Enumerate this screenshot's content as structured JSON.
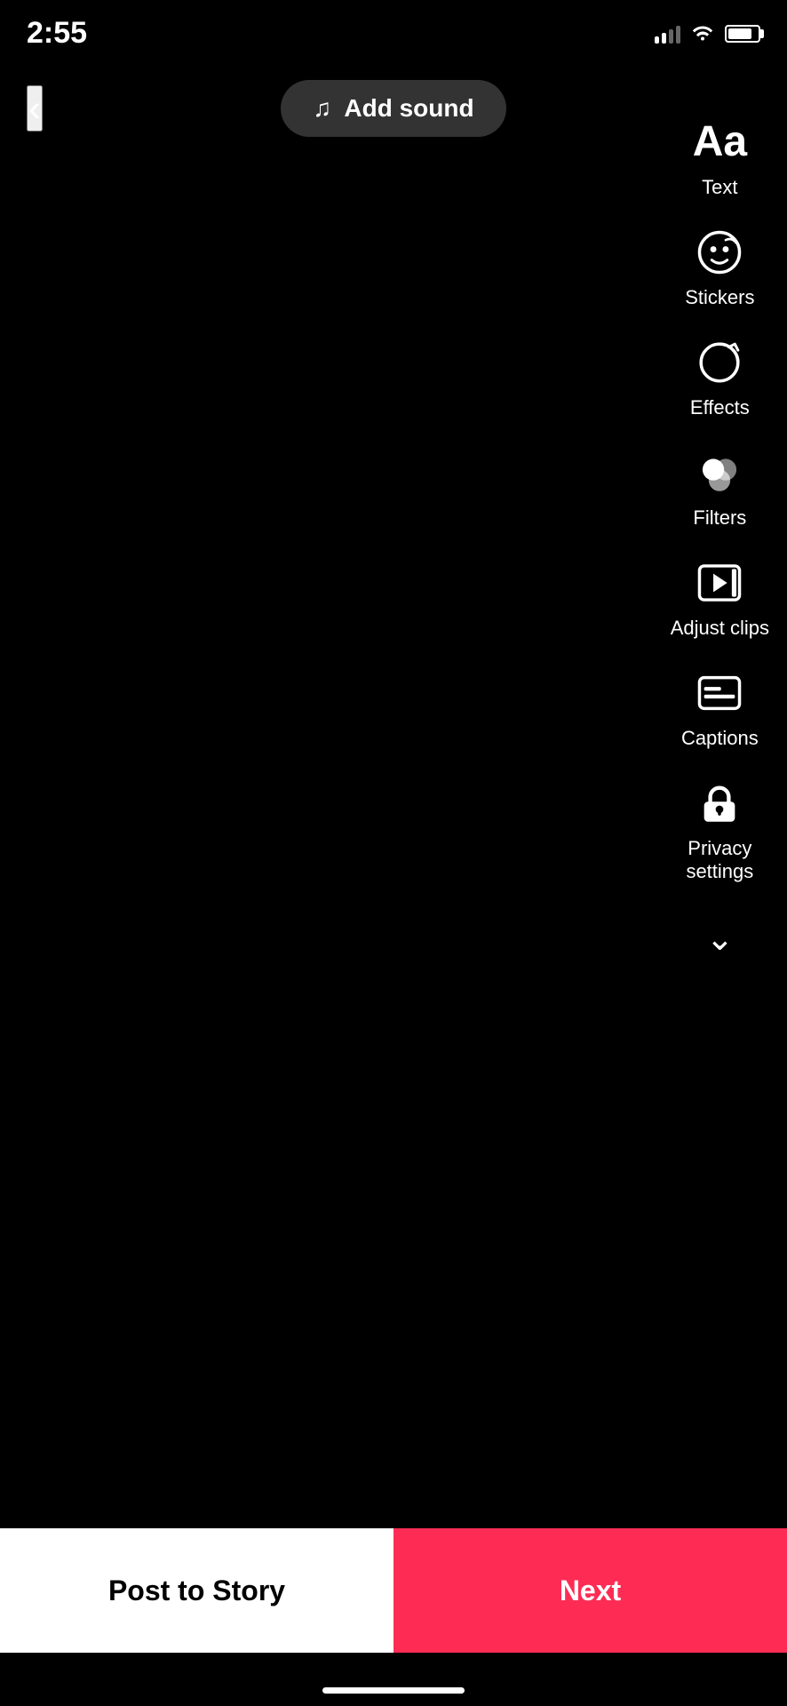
{
  "statusBar": {
    "time": "2:55"
  },
  "topBar": {
    "backLabel": "<",
    "addSoundLabel": "Add sound"
  },
  "toolbar": {
    "items": [
      {
        "id": "text",
        "label": "Text",
        "iconType": "text"
      },
      {
        "id": "stickers",
        "label": "Stickers",
        "iconType": "stickers"
      },
      {
        "id": "effects",
        "label": "Effects",
        "iconType": "effects"
      },
      {
        "id": "filters",
        "label": "Filters",
        "iconType": "filters"
      },
      {
        "id": "adjust-clips",
        "label": "Adjust clips",
        "iconType": "adjust-clips"
      },
      {
        "id": "captions",
        "label": "Captions",
        "iconType": "captions"
      },
      {
        "id": "privacy-settings",
        "label": "Privacy settings",
        "iconType": "privacy"
      }
    ]
  },
  "bottomButtons": {
    "postToStory": "Post to Story",
    "next": "Next"
  }
}
